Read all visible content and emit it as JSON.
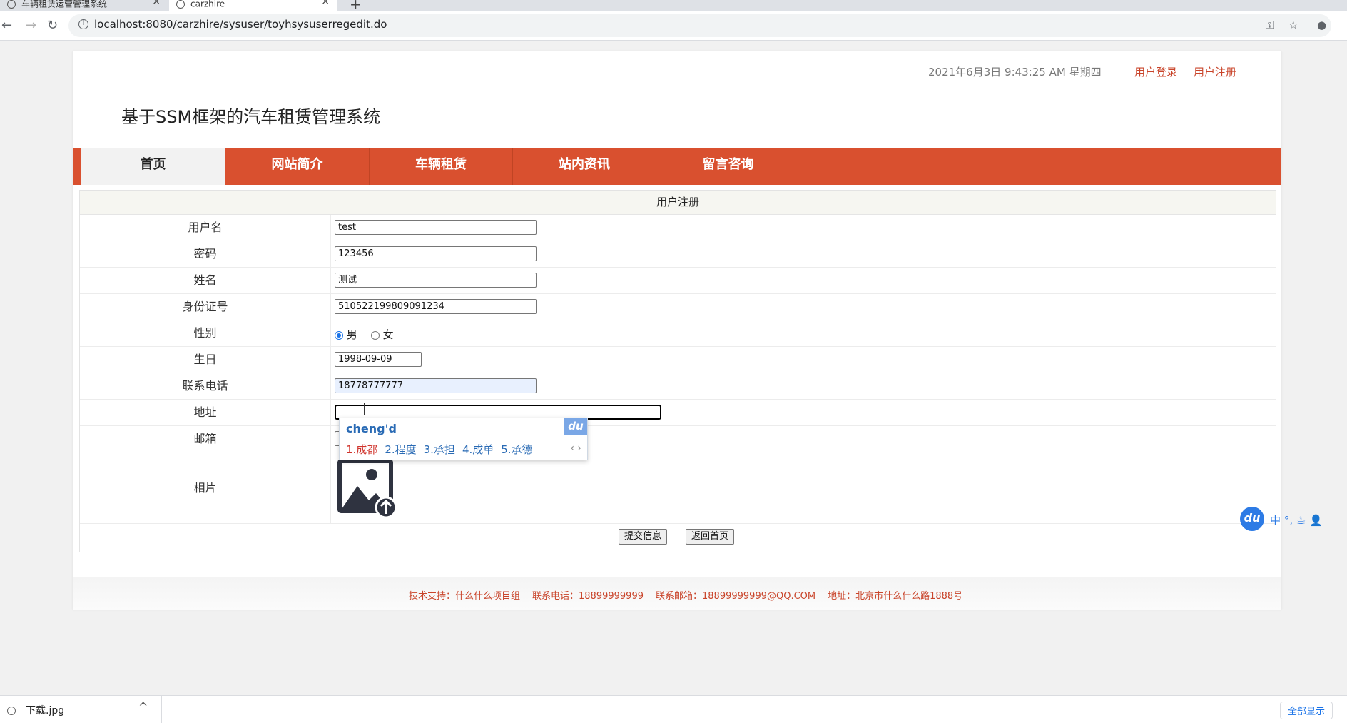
{
  "browser": {
    "tabs": [
      {
        "title": "车辆租赁运营管理系统"
      },
      {
        "title": "carzhire"
      }
    ],
    "new_tab": "+",
    "url": "localhost:8080/carzhire/sysuser/toyhsysuserregedit.do",
    "info_icon": "i"
  },
  "header": {
    "datetime": "2021年6月3日 9:43:25 AM 星期四",
    "login_link": "用户登录",
    "register_link": "用户注册",
    "site_title": "基于SSM框架的汽车租赁管理系统"
  },
  "nav": {
    "items": [
      {
        "label": "首页"
      },
      {
        "label": "网站简介"
      },
      {
        "label": "车辆租赁"
      },
      {
        "label": "站内资讯"
      },
      {
        "label": "留言咨询"
      }
    ]
  },
  "form": {
    "heading": "用户注册",
    "fields": {
      "username": {
        "label": "用户名",
        "value": "test"
      },
      "password": {
        "label": "密码",
        "value": "123456"
      },
      "name": {
        "label": "姓名",
        "value": "测试"
      },
      "idcard": {
        "label": "身份证号",
        "value": "510522199809091234"
      },
      "gender": {
        "label": "性别",
        "options": [
          "男",
          "女"
        ],
        "selected": "男"
      },
      "birthday": {
        "label": "生日",
        "value": "1998-09-09"
      },
      "phone": {
        "label": "联系电话",
        "value": "18778777777"
      },
      "address": {
        "label": "地址",
        "value": ""
      },
      "email": {
        "label": "邮箱",
        "value": ""
      },
      "photo": {
        "label": "相片"
      }
    },
    "submit_label": "提交信息",
    "back_label": "返回首页"
  },
  "footer": {
    "support": "技术支持：什么什么项目组",
    "phone": "联系电话：18899999999",
    "email": "联系邮箱：18899999999@QQ.COM",
    "address": "地址：北京市什么什么路1888号"
  },
  "ime": {
    "pinyin": "cheng'd",
    "logo": "du",
    "candidates": [
      "1.成都",
      "2.程度",
      "3.承担",
      "4.成单",
      "5.承德"
    ],
    "toolbar": "中 °, ☕ 👤"
  },
  "downloads": {
    "file": "下载.jpg",
    "show_all": "全部显示"
  },
  "colors": {
    "accent": "#d9502f",
    "link": "#c9442a",
    "ime_blue": "#2d7be5"
  }
}
